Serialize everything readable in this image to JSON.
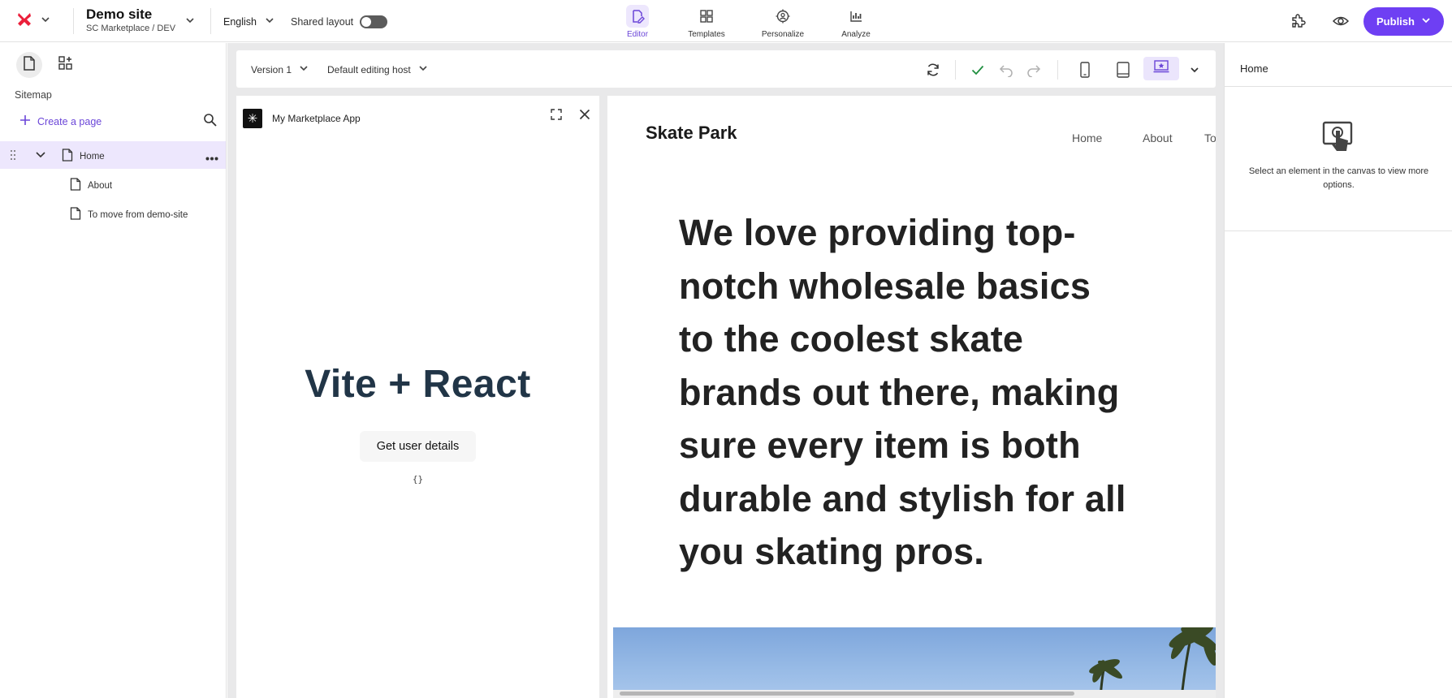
{
  "site": {
    "title": "Demo site",
    "subtitle": "SC Marketplace / DEV"
  },
  "language": "English",
  "shared_layout_label": "Shared layout",
  "nav": [
    {
      "label": "Editor"
    },
    {
      "label": "Templates"
    },
    {
      "label": "Personalize"
    },
    {
      "label": "Analyze"
    }
  ],
  "publish_label": "Publish",
  "sidebar": {
    "heading": "Sitemap",
    "create_label": "Create a page",
    "tree": [
      {
        "label": "Home"
      },
      {
        "label": "About"
      },
      {
        "label": "To move from demo-site"
      }
    ]
  },
  "canvas": {
    "version": "Version 1",
    "host": "Default editing host"
  },
  "app_panel": {
    "title": "My Marketplace App",
    "heading": "Vite + React",
    "button_label": "Get user details",
    "output": "{}"
  },
  "preview": {
    "brand": "Skate Park",
    "nav": [
      "Home",
      "About",
      "To"
    ],
    "hero": "We love providing top-notch wholesale basics to the coolest skate brands out there, making sure every item is both durable and stylish for all you skating pros."
  },
  "right_panel": {
    "title": "Home",
    "message": "Select an element in the canvas to view more options."
  },
  "colors": {
    "accent": "#6e3ff3",
    "accent_light": "#ede7fd",
    "success": "#1e8e3e"
  }
}
